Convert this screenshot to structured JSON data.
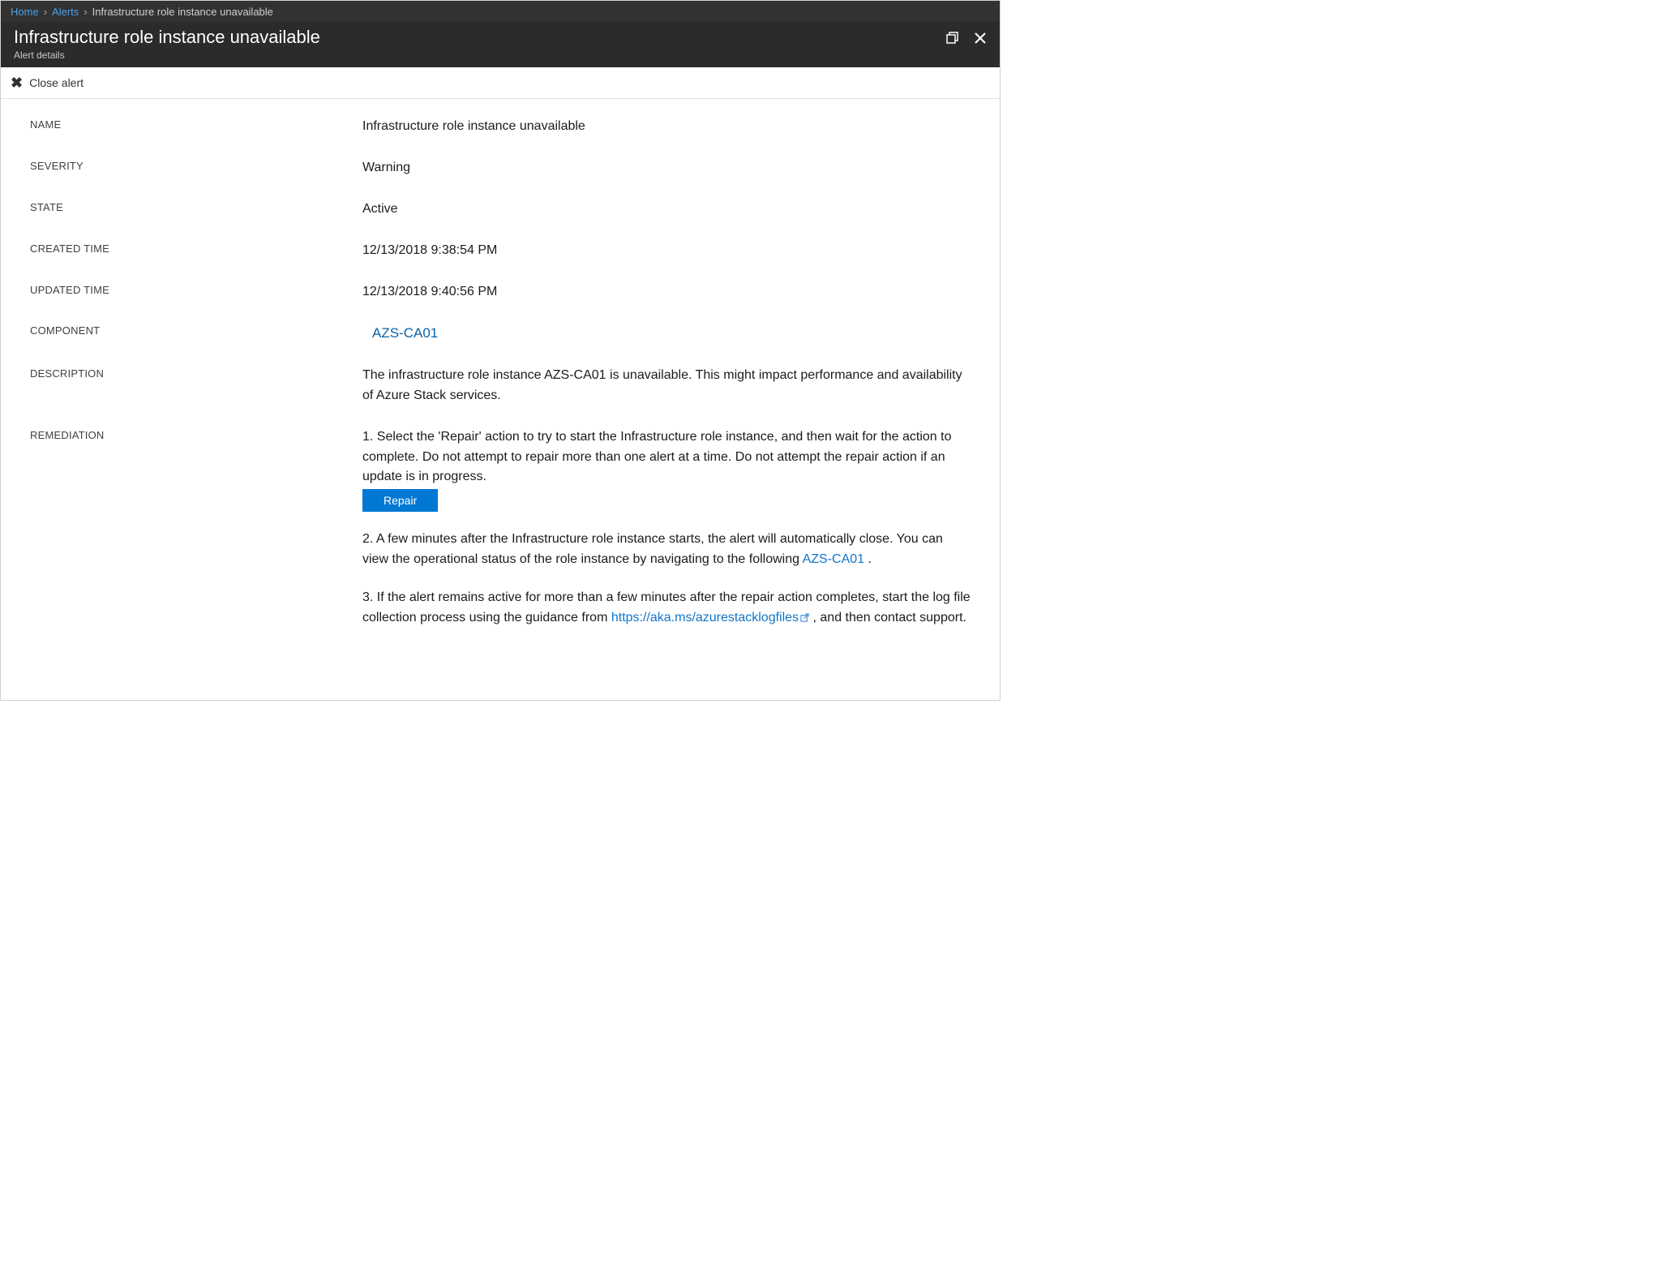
{
  "breadcrumb": {
    "home": "Home",
    "alerts": "Alerts",
    "current": "Infrastructure role instance unavailable"
  },
  "header": {
    "title": "Infrastructure role instance unavailable",
    "subtitle": "Alert details"
  },
  "commands": {
    "close_alert": "Close alert"
  },
  "fields": {
    "name_label": "NAME",
    "name_value": "Infrastructure role instance unavailable",
    "severity_label": "SEVERITY",
    "severity_value": "Warning",
    "state_label": "STATE",
    "state_value": "Active",
    "created_label": "CREATED TIME",
    "created_value": "12/13/2018 9:38:54 PM",
    "updated_label": "UPDATED TIME",
    "updated_value": "12/13/2018 9:40:56 PM",
    "component_label": "COMPONENT",
    "component_value": "AZS-CA01",
    "description_label": "DESCRIPTION",
    "description_value": "The infrastructure role instance AZS-CA01 is unavailable. This might impact performance and availability of Azure Stack services.",
    "remediation_label": "REMEDIATION"
  },
  "remediation": {
    "step1": "1. Select the 'Repair' action to try to start the Infrastructure role instance, and then wait for the action to complete. Do not attempt to repair more than one alert at a time. Do not attempt the repair action if an update is in progress.",
    "repair_button": "Repair",
    "step2_pre": "2. A few minutes after the Infrastructure role instance starts, the alert will automatically close. You can view the operational status of the role instance by navigating to the following ",
    "step2_link": "AZS-CA01",
    "step2_post": " .",
    "step3_pre": "3. If the alert remains active for more than a few minutes after the repair action completes, start the log file collection process using the guidance from ",
    "step3_link": "https://aka.ms/azurestacklogfiles",
    "step3_post": " , and then contact support."
  }
}
